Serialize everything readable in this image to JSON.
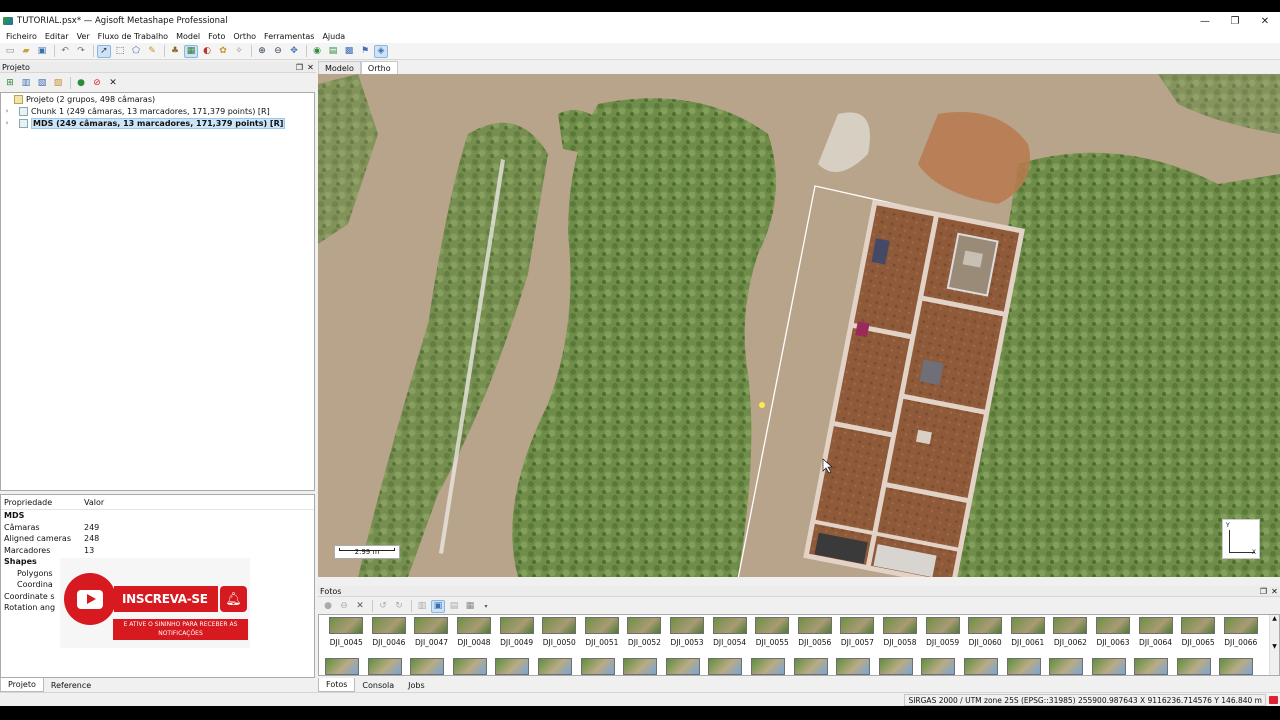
{
  "window": {
    "title": "TUTORIAL.psx* — Agisoft Metashape Professional",
    "minimize_glyph": "—",
    "restore_glyph": "❐",
    "close_glyph": "✕"
  },
  "menu": [
    "Ficheiro",
    "Editar",
    "Ver",
    "Fluxo de Trabalho",
    "Model",
    "Foto",
    "Ortho",
    "Ferramentas",
    "Ajuda"
  ],
  "toolbar_icons": [
    "new-icon",
    "open-icon",
    "save-icon",
    "undo-icon",
    "redo-icon",
    "navigation-icon",
    "rectangle-selection-icon",
    "shape-icon",
    "ruler-icon",
    "brush-icon",
    "patch-icon",
    "delete-icon",
    "crop-icon",
    "intersect-icon",
    "zoom-in-icon",
    "zoom-out-icon",
    "move-icon",
    "globe-icon",
    "grid-icon",
    "photo-icon",
    "flag-icon",
    "camera-icon"
  ],
  "project_panel": {
    "title": "Projeto",
    "tree": [
      {
        "label": "Projeto (2 grupos, 498 câmaras)",
        "level": 0,
        "selected": false
      },
      {
        "label": "Chunk 1 (249 câmaras, 13 marcadores, 171,379 points) [R]",
        "level": 1,
        "selected": false
      },
      {
        "label": "MDS (249 câmaras, 13 marcadores, 171,379 points) [R]",
        "level": 1,
        "selected": true
      }
    ]
  },
  "properties": {
    "header_key": "Propriedade",
    "header_value": "Valor",
    "rows": [
      {
        "k": "MDS",
        "v": "",
        "style": "bold"
      },
      {
        "k": "Câmaras",
        "v": "249",
        "style": ""
      },
      {
        "k": "Aligned cameras",
        "v": "248",
        "style": ""
      },
      {
        "k": "Marcadores",
        "v": "13",
        "style": ""
      },
      {
        "k": "Shapes",
        "v": "",
        "style": "bold"
      },
      {
        "k": "Polygons",
        "v": "",
        "style": "ind"
      },
      {
        "k": "Coordina",
        "v": "",
        "style": "ind"
      },
      {
        "k": "Coordinate s",
        "v": "",
        "style": ""
      },
      {
        "k": "Rotation ang",
        "v": "",
        "style": ""
      }
    ]
  },
  "subscribe_overlay": {
    "button": "INSCREVA-SE",
    "note": "E ATIVE O SININHO PARA RECEBER AS NOTIFICAÇÕES"
  },
  "left_tabs": [
    "Projeto",
    "Reference"
  ],
  "view_tabs": [
    "Modelo",
    "Ortho"
  ],
  "active_view_tab": "Ortho",
  "viewport": {
    "scale_label": "2.99 m",
    "axis_y": "Y",
    "axis_x": "X"
  },
  "photos_panel": {
    "title": "Fotos",
    "thumbnails": [
      "DJI_0045",
      "DJI_0046",
      "DJI_0047",
      "DJI_0048",
      "DJI_0049",
      "DJI_0050",
      "DJI_0051",
      "DJI_0052",
      "DJI_0053",
      "DJI_0054",
      "DJI_0055",
      "DJI_0056",
      "DJI_0057",
      "DJI_0058",
      "DJI_0059",
      "DJI_0060",
      "DJI_0061",
      "DJI_0062",
      "DJI_0063",
      "DJI_0064",
      "DJI_0065",
      "DJI_0066"
    ]
  },
  "bottom_tabs": [
    "Fotos",
    "Consola",
    "Jobs"
  ],
  "status": {
    "coords": "SIRGAS 2000 / UTM zone 25S (EPSG::31985)  255900.987643 X  9116236.714576 Y  146.840 m"
  },
  "colors": {
    "subscribe_red": "#d71920",
    "selection_blue": "#cce4f7"
  }
}
